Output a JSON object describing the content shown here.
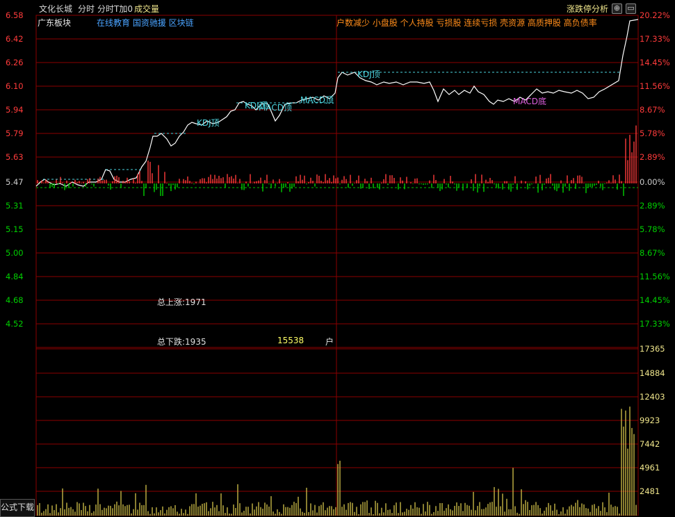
{
  "header": {
    "stock_name": "文化长城",
    "tab_intraday": "分时",
    "tab_intraday_t0": "分时T加0",
    "tab_volume": "成交量",
    "analysis_label": "涨跌停分析",
    "settings_icon": "gear-icon",
    "window_icon": "restore-icon"
  },
  "sector": {
    "name": "广东板块",
    "concepts": "在线教育 国资驰援 区块链",
    "features": "户数减少 小盘股 个人持股 亏损股 连续亏损 壳资源 高质押股 高负债率"
  },
  "price_axis": {
    "left": [
      "6.58",
      "6.42",
      "6.26",
      "6.10",
      "5.94",
      "5.79",
      "5.63",
      "5.47",
      "5.31",
      "5.15",
      "5.00",
      "4.84",
      "4.68",
      "4.52"
    ],
    "right": [
      "20.22%",
      "17.33%",
      "14.45%",
      "11.56%",
      "8.67%",
      "5.78%",
      "2.89%",
      "0.00%",
      "2.89%",
      "5.78%",
      "8.67%",
      "11.56%",
      "14.45%",
      "17.33%"
    ]
  },
  "volume_axis": [
    "17365",
    "14884",
    "12403",
    "9923",
    "7442",
    "4961",
    "2481"
  ],
  "stats": {
    "total_up_label": "总上涨:1971",
    "total_down_label": "总下跌:1935",
    "holders_count": "15538",
    "holders_unit": "户"
  },
  "signals": [
    {
      "text": "KDJ顶"
    },
    {
      "text": "KDJ顶"
    },
    {
      "text": "MACD顶"
    },
    {
      "text": "MACD顶"
    },
    {
      "text": "KDJ顶"
    },
    {
      "text": "MACD底"
    }
  ],
  "footer": {
    "formula_download": "公式下载"
  },
  "colors": {
    "up": "#ff3b3b",
    "down": "#00d000",
    "price_line": "#ffffff",
    "grid": "#8b0000",
    "volume": "#d4c44a",
    "concept": "#4aa3ff",
    "feature": "#ff8c1a",
    "signal": "#4dd6e0",
    "macd_bottom": "#e060e0"
  }
}
